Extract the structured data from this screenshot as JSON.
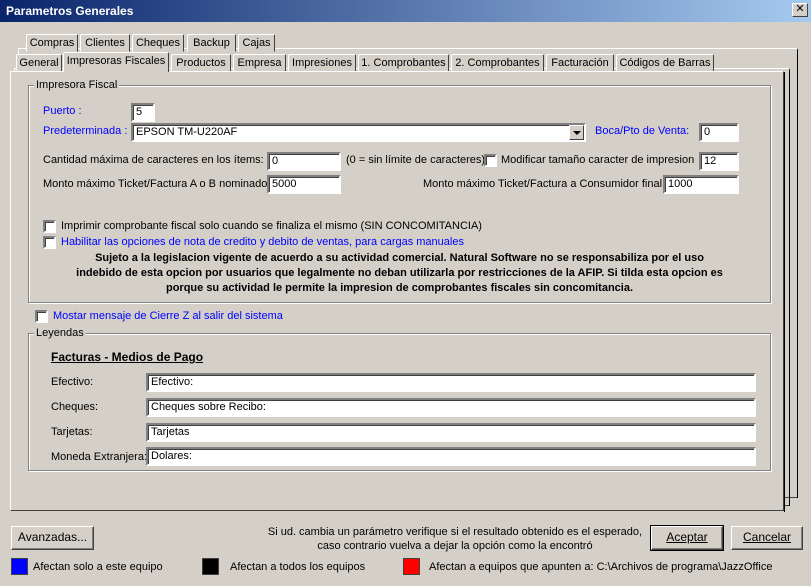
{
  "window": {
    "title": "Parametros Generales",
    "close_glyph": "✕"
  },
  "tabs_row1": [
    "Compras",
    "Clientes",
    "Cheques",
    "Backup",
    "Cajas"
  ],
  "tabs_row2": [
    "General",
    "Impresoras Fiscales",
    "Productos",
    "Empresa",
    "Impresiones",
    "1. Comprobantes",
    "2. Comprobantes",
    "Facturación",
    "Códigos de Barras"
  ],
  "active_tab": "Impresoras Fiscales",
  "impresora": {
    "group_title": "Impresora Fiscal",
    "puerto_label": "Puerto :",
    "puerto_value": "5",
    "predeterminada_label": "Predeterminada :",
    "predeterminada_value": "EPSON TM-U220AF",
    "boca_label": "Boca/Pto de Venta:",
    "boca_value": "0",
    "cant_max_label": "Cantidad máxima de caracteres en los ítems:",
    "cant_max_value": "0",
    "cant_max_hint": "(0 = sin límite de caracteres)",
    "modificar_label": "Modificar tamaño caracter de impresion",
    "modificar_value": "12",
    "monto_ab_label": "Monto máximo Ticket/Factura A o B nominado",
    "monto_ab_value": "5000",
    "monto_cf_label": "Monto máximo Ticket/Factura a Consumidor final",
    "monto_cf_value": "1000",
    "imprimir_label": "Imprimir comprobante fiscal solo cuando se finaliza el mismo (SIN CONCOMITANCIA)",
    "habilitar_label": "Habilitar las opciones de nota de credito y debito de ventas, para cargas manuales",
    "warning_line1": "Sujeto a la legislacion vigente de acuerdo a su actividad comercial. Natural Software no se responsabiliza por el uso",
    "warning_line2": "indebido de esta opcion por usuarios que legalmente no deban utilizarla por restricciones de la AFIP. Si tilda esta opcion es",
    "warning_line3": "porque su actividad le permite la impresion de comprobantes fiscales sin concomitancia."
  },
  "mostrar_label": "Mostar mensaje de Cierre Z al salir del sistema",
  "leyendas": {
    "group_title": "Leyendas",
    "heading": "Facturas - Medios de Pago",
    "rows": [
      {
        "label": "Efectivo:",
        "value": "Efectivo:"
      },
      {
        "label": "Cheques:",
        "value": "Cheques sobre Recibo:"
      },
      {
        "label": "Tarjetas:",
        "value": "Tarjetas"
      },
      {
        "label": "Moneda Extranjera:",
        "value": "Dolares:"
      }
    ]
  },
  "footer": {
    "avanzadas": "Avanzadas...",
    "info_line1": "Si ud. cambia un parámetro verifique si el resultado obtenido es el esperado,",
    "info_line2": "caso contrario vuelva a dejar la opción como la encontró",
    "aceptar": "Aceptar",
    "cancelar": "Cancelar",
    "legend_blue": "Afectan solo a este equipo",
    "legend_black": "Afectan a todos los equipos",
    "legend_red": "Afectan a equipos que apunten a: C:\\Archivos de programa\\JazzOffice"
  },
  "colors": {
    "blue": "#0000ff",
    "black": "#000000",
    "red": "#ff0000",
    "title_start": "#0a246a"
  }
}
